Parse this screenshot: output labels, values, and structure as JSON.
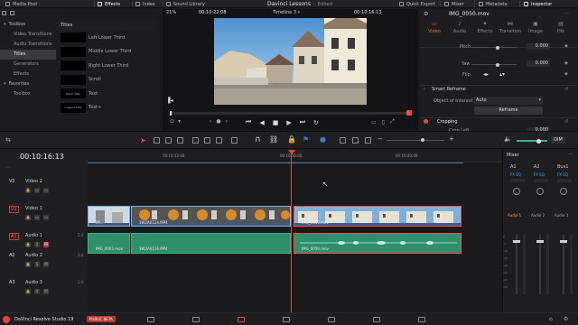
{
  "topbar": {
    "media_pool": "Media Pool",
    "effects": "Effects",
    "index": "Index",
    "sound_library": "Sound Library",
    "project_title": "Davinci Lessons",
    "edited": "Edited",
    "quick_export": "Quick Export",
    "mixer": "Mixer",
    "metadata": "Metadata",
    "inspector": "Inspector"
  },
  "effects_panel": {
    "tree": [
      {
        "label": "Toolbox",
        "type": "head"
      },
      {
        "label": "Video Transitions",
        "type": "item"
      },
      {
        "label": "Audio Transitions",
        "type": "item"
      },
      {
        "label": "Titles",
        "type": "item",
        "selected": true
      },
      {
        "label": "Generators",
        "type": "item"
      },
      {
        "label": "Effects",
        "type": "item"
      },
      {
        "label": "Favorites",
        "type": "head"
      },
      {
        "label": "Toolbox",
        "type": "item"
      }
    ],
    "section_title": "Titles",
    "titles": [
      {
        "thumb": "",
        "label": "Left Lower Third"
      },
      {
        "thumb": "",
        "label": "Middle Lower Third"
      },
      {
        "thumb": "",
        "label": "Right Lower Third"
      },
      {
        "thumb": "",
        "label": "Scroll"
      },
      {
        "thumb": "Basic Title",
        "label": "Text"
      },
      {
        "thumb": "Custom Title",
        "label": "Text+"
      }
    ]
  },
  "viewer": {
    "zoom": "21%",
    "source_timecode": "00:10:22:08",
    "timeline_name": "Timeline 3",
    "record_timecode": "00:10:16:13"
  },
  "inspector": {
    "clip_name": "IMG_0050.mov",
    "tabs": [
      "Video",
      "Audio",
      "Effects",
      "Transition",
      "Image",
      "File"
    ],
    "active_tab": "Video",
    "pitch_label": "Pitch",
    "pitch_value": "0.000",
    "yaw_label": "Yaw",
    "yaw_value": "0.000",
    "flip_label": "Flip",
    "smart_reframe": "Smart Reframe",
    "object_label": "Object of Interest",
    "object_value": "Auto",
    "reframe_button": "Reframe",
    "cropping": "Cropping",
    "crop_left": "Crop Left",
    "crop_left_value": "0.000"
  },
  "timeline": {
    "timecode": "00:10:16:13",
    "ruler": [
      "00:10:12:00",
      "00:10:16:00",
      "00:10:20:00"
    ],
    "tracks": [
      {
        "id": "V2",
        "name": "Video 2"
      },
      {
        "id": "V1",
        "name": "Video 1"
      },
      {
        "id": "A1",
        "name": "Audio 1",
        "ch": "2.0"
      },
      {
        "id": "A2",
        "name": "Audio 2",
        "ch": "2.0"
      },
      {
        "id": "A3",
        "name": "Audio 3",
        "ch": "2.0"
      }
    ],
    "clips": {
      "v1_a": "IM...",
      "v1_b": "3W2A0124.MP4",
      "v1_c": "IMG_0050.mov",
      "a1_a": "IMG_0003.mov",
      "a1_b": "3W2A0124.MP4",
      "a1_c": "IMG_0050.mov"
    }
  },
  "mixer": {
    "title": "Mixer",
    "channels": [
      "A1",
      "A2",
      "Bus1"
    ],
    "eq": "EQ",
    "bottom": [
      "Audio 1",
      "Audio 2",
      "Audio 3"
    ],
    "dim": "DIM",
    "scale": [
      "0",
      "-5",
      "-10",
      "-15",
      "-20",
      "-30",
      "-40",
      "-50"
    ]
  },
  "statusbar": {
    "app": "DaVinci Resolve Studio 19",
    "badge": "PUBLIC BETA"
  },
  "colors": {
    "accent_red": "#e8463c",
    "video_clip": "#3c5d86",
    "audio_clip": "#2e8f6a"
  }
}
